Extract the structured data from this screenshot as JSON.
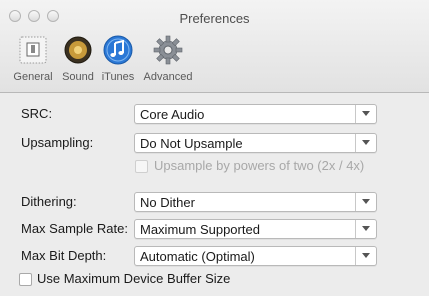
{
  "window": {
    "title": "Preferences"
  },
  "toolbar": {
    "items": [
      {
        "label": "General",
        "icon": "switch-icon"
      },
      {
        "label": "Sound",
        "icon": "speaker-icon"
      },
      {
        "label": "iTunes",
        "icon": "music-note-icon"
      },
      {
        "label": "Advanced",
        "icon": "gear-icon"
      }
    ]
  },
  "settings": {
    "src": {
      "label": "SRC:",
      "value": "Core Audio"
    },
    "upsampling": {
      "label": "Upsampling:",
      "value": "Do Not Upsample"
    },
    "upsample_powers": {
      "label": "Upsample by powers of two (2x / 4x)",
      "checked": false,
      "enabled": false
    },
    "dithering": {
      "label": "Dithering:",
      "value": "No Dither"
    },
    "max_sample_rate": {
      "label": "Max Sample Rate:",
      "value": "Maximum Supported"
    },
    "max_bit_depth": {
      "label": "Max Bit Depth:",
      "value": "Automatic (Optimal)"
    },
    "max_buffer": {
      "label": "Use Maximum Device Buffer Size",
      "checked": false
    }
  },
  "colors": {
    "itunes_blue": "#2b78d6",
    "disabled_text": "#a8a8a8"
  }
}
